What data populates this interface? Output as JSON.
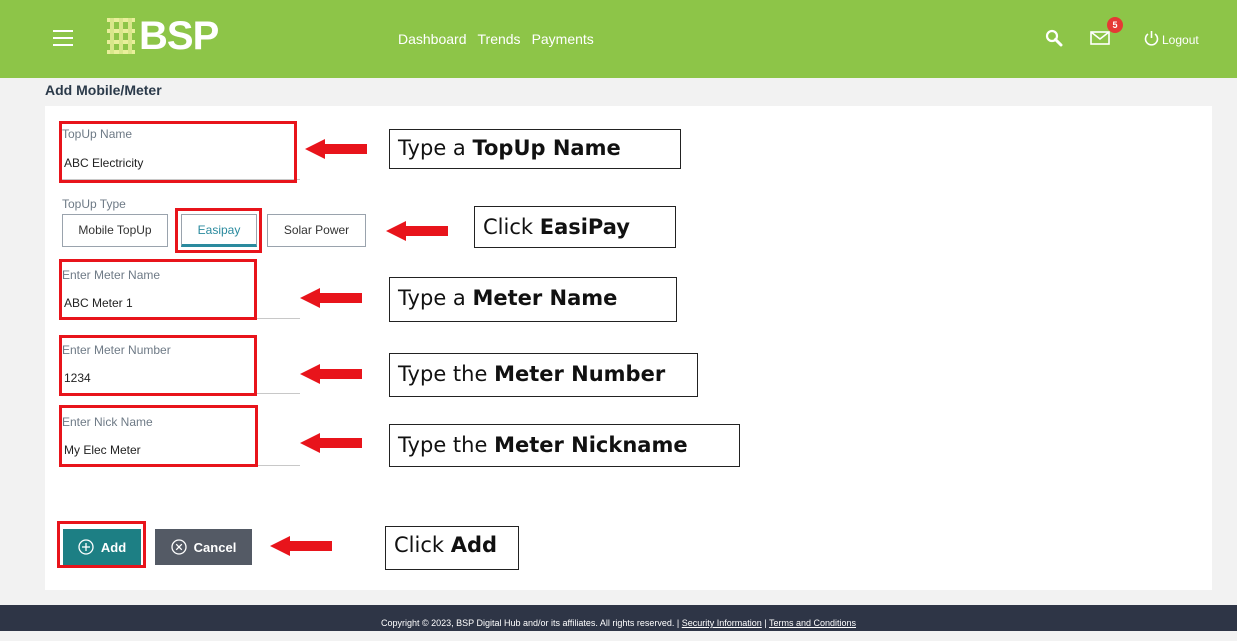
{
  "header": {
    "logo_text": "BSP",
    "nav": [
      "Dashboard",
      "Trends",
      "Payments"
    ],
    "notification_count": "5",
    "logout_label": "Logout"
  },
  "page": {
    "title": "Add Mobile/Meter"
  },
  "form": {
    "topup_name": {
      "label": "TopUp Name",
      "value": "ABC Electricity"
    },
    "topup_type": {
      "label": "TopUp Type",
      "options": [
        "Mobile TopUp",
        "Easipay",
        "Solar Power"
      ],
      "selected": "Easipay"
    },
    "meter_name": {
      "label": "Enter Meter Name",
      "value": "ABC Meter 1"
    },
    "meter_number": {
      "label": "Enter Meter Number",
      "value": "1234"
    },
    "nick_name": {
      "label": "Enter Nick Name",
      "value": "My Elec Meter"
    },
    "add_label": "Add",
    "cancel_label": "Cancel"
  },
  "callouts": {
    "topup_name": {
      "prefix": "Type a ",
      "bold": "TopUp Name"
    },
    "easipay": {
      "prefix": "Click ",
      "bold": "EasiPay"
    },
    "meter_name": {
      "prefix": "Type a ",
      "bold": "Meter Name"
    },
    "meter_number": {
      "prefix": "Type the ",
      "bold": "Meter Number"
    },
    "nick_name": {
      "prefix": "Type the ",
      "bold": "Meter Nickname"
    },
    "add": {
      "prefix": "Click ",
      "bold": "Add"
    }
  },
  "footer": {
    "copyright": "Copyright © 2023, BSP Digital Hub and/or its affiliates. All rights reserved. | ",
    "security_link": "Security Information",
    "separator": " | ",
    "terms_link": "Terms and Conditions"
  },
  "colors": {
    "header_bg": "#8dc548",
    "annotation_red": "#e8141b",
    "primary_button": "#1d7f84",
    "footer_bg": "#2e3546"
  }
}
